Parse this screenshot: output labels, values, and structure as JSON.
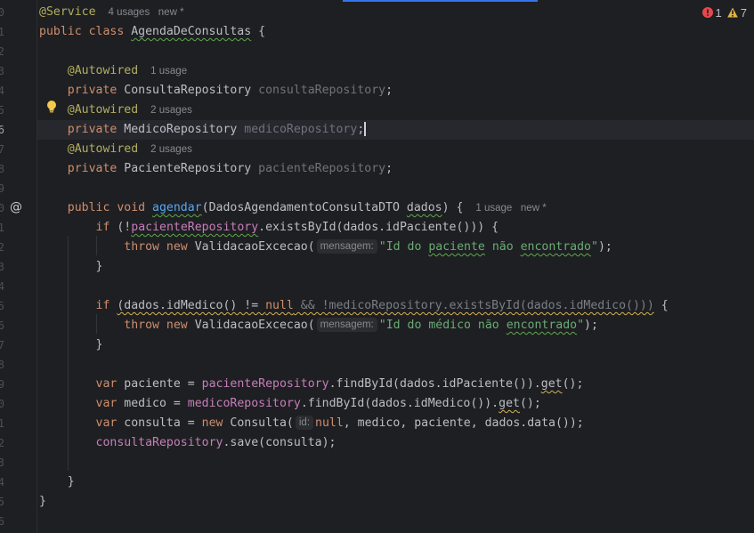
{
  "editor": {
    "current_line_index": 6,
    "line_numbers": [
      "0",
      "1",
      "2",
      "3",
      "4",
      "5",
      "6",
      "7",
      "8",
      "9",
      "0",
      "1",
      "2",
      "3",
      "4",
      "5",
      "6",
      "7",
      "8",
      "9",
      "0",
      "1",
      "2",
      "3",
      "4",
      "5",
      "6"
    ],
    "inspections": {
      "errors": "1",
      "warnings": "7",
      "error_color": "#e5484d",
      "warning_color": "#e2b440"
    },
    "lines": [
      [
        {
          "t": "@Service",
          "c": "annotation"
        },
        {
          "hint": "4 usages   new *"
        }
      ],
      [
        {
          "t": "public ",
          "c": "keyword"
        },
        {
          "t": "class ",
          "c": "keyword"
        },
        {
          "t": "AgendaDeConsultas",
          "c": "type",
          "sq": "green"
        },
        {
          "t": " {",
          "c": "plain"
        }
      ],
      [],
      [
        {
          "t": "    "
        },
        {
          "t": "@Autowired",
          "c": "annotation"
        },
        {
          "hint": "1 usage"
        }
      ],
      [
        {
          "t": "    "
        },
        {
          "t": "private ",
          "c": "keyword"
        },
        {
          "t": "ConsultaRepository ",
          "c": "type"
        },
        {
          "t": "consultaRepository",
          "c": "field-unused"
        },
        {
          "t": ";",
          "c": "plain"
        }
      ],
      [
        {
          "t": "    "
        },
        {
          "t": "@Autowired",
          "c": "annotation"
        },
        {
          "hint": "2 usages"
        }
      ],
      [
        {
          "t": "    "
        },
        {
          "t": "private ",
          "c": "keyword"
        },
        {
          "t": "MedicoRepository ",
          "c": "type"
        },
        {
          "t": "medicoRepository",
          "c": "field-unused"
        },
        {
          "t": ";",
          "c": "plain"
        },
        {
          "caret": true
        }
      ],
      [
        {
          "t": "    "
        },
        {
          "t": "@Autowired",
          "c": "annotation"
        },
        {
          "hint": "2 usages"
        }
      ],
      [
        {
          "t": "    "
        },
        {
          "t": "private ",
          "c": "keyword"
        },
        {
          "t": "PacienteRepository ",
          "c": "type"
        },
        {
          "t": "pacienteRepository",
          "c": "field-unused"
        },
        {
          "t": ";",
          "c": "plain"
        }
      ],
      [],
      [
        {
          "t": "    "
        },
        {
          "t": "public ",
          "c": "keyword"
        },
        {
          "t": "void ",
          "c": "keyword"
        },
        {
          "t": "agendar",
          "c": "method",
          "sq": "green"
        },
        {
          "t": "(DadosAgendamentoConsultaDTO ",
          "c": "plain"
        },
        {
          "t": "dados",
          "c": "param",
          "sq": "green"
        },
        {
          "t": ") {",
          "c": "plain"
        },
        {
          "hint": "1 usage   new *"
        }
      ],
      [
        {
          "t": "        "
        },
        {
          "t": "if ",
          "c": "keyword"
        },
        {
          "t": "(!",
          "c": "plain"
        },
        {
          "t": "pacienteRepository",
          "c": "field",
          "sq": "green"
        },
        {
          "t": ".existsById(dados.idPaciente())) {",
          "c": "plain"
        }
      ],
      [
        {
          "t": "            "
        },
        {
          "t": "throw ",
          "c": "keyword"
        },
        {
          "t": "new ",
          "c": "keyword"
        },
        {
          "t": "ValidacaoExcecao(",
          "c": "plain"
        },
        {
          "ph": "mensagem:"
        },
        {
          "t": "\"Id do ",
          "c": "string"
        },
        {
          "t": "paciente",
          "c": "string",
          "sq": "green"
        },
        {
          "t": " não ",
          "c": "string"
        },
        {
          "t": "encontrado",
          "c": "string",
          "sq": "green"
        },
        {
          "t": "\"",
          "c": "string"
        },
        {
          "t": ");",
          "c": "plain"
        }
      ],
      [
        {
          "t": "        "
        },
        {
          "t": "}",
          "c": "plain"
        }
      ],
      [],
      [
        {
          "t": "        "
        },
        {
          "t": "if ",
          "c": "keyword"
        },
        {
          "t": "(dados.idMedico() != ",
          "c": "plain",
          "sq": "yellow"
        },
        {
          "t": "null",
          "c": "keyword",
          "sq": "yellow"
        },
        {
          "t": " && !medicoRepository.existsById(dados.idMedico()))",
          "c": "dim",
          "sq": "yellow"
        },
        {
          "t": " {",
          "c": "plain"
        }
      ],
      [
        {
          "t": "            "
        },
        {
          "t": "throw ",
          "c": "keyword"
        },
        {
          "t": "new ",
          "c": "keyword"
        },
        {
          "t": "ValidacaoExcecao(",
          "c": "plain"
        },
        {
          "ph": "mensagem:"
        },
        {
          "t": "\"Id do médico não ",
          "c": "string"
        },
        {
          "t": "encontrado",
          "c": "string",
          "sq": "green"
        },
        {
          "t": "\"",
          "c": "string"
        },
        {
          "t": ");",
          "c": "plain"
        }
      ],
      [
        {
          "t": "        "
        },
        {
          "t": "}",
          "c": "plain"
        }
      ],
      [],
      [
        {
          "t": "        "
        },
        {
          "t": "var ",
          "c": "keyword"
        },
        {
          "t": "paciente = ",
          "c": "plain"
        },
        {
          "t": "pacienteRepository",
          "c": "field"
        },
        {
          "t": ".findById(dados.idPaciente()).",
          "c": "plain"
        },
        {
          "t": "get",
          "c": "plain",
          "sq": "yellow"
        },
        {
          "t": "();",
          "c": "plain"
        }
      ],
      [
        {
          "t": "        "
        },
        {
          "t": "var ",
          "c": "keyword"
        },
        {
          "t": "medico = ",
          "c": "plain"
        },
        {
          "t": "medicoRepository",
          "c": "field"
        },
        {
          "t": ".findById(dados.idMedico()).",
          "c": "plain"
        },
        {
          "t": "get",
          "c": "plain",
          "sq": "yellow"
        },
        {
          "t": "();",
          "c": "plain"
        }
      ],
      [
        {
          "t": "        "
        },
        {
          "t": "var ",
          "c": "keyword"
        },
        {
          "t": "consulta = ",
          "c": "plain"
        },
        {
          "t": "new ",
          "c": "keyword"
        },
        {
          "t": "Consulta(",
          "c": "plain"
        },
        {
          "ph": "id:"
        },
        {
          "t": "null",
          "c": "keyword"
        },
        {
          "t": ", medico, paciente, dados.data());",
          "c": "plain"
        }
      ],
      [
        {
          "t": "        "
        },
        {
          "t": "consultaRepository",
          "c": "field"
        },
        {
          "t": ".save(consulta);",
          "c": "plain"
        }
      ],
      [],
      [
        {
          "t": "    "
        },
        {
          "t": "}",
          "c": "plain"
        }
      ],
      [
        {
          "t": "}",
          "c": "plain"
        }
      ],
      []
    ]
  }
}
